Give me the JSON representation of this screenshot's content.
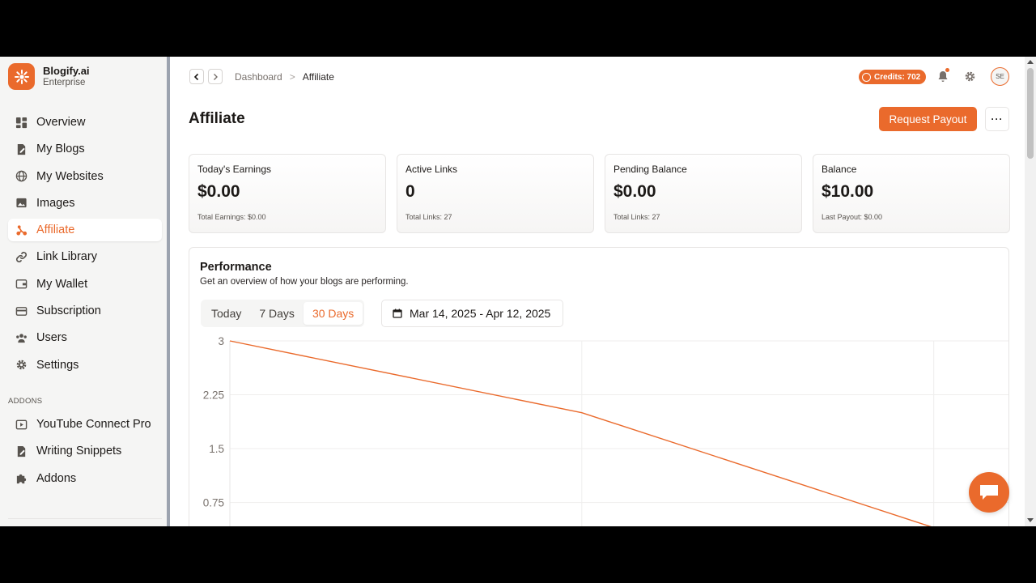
{
  "brand": {
    "name": "Blogify.ai",
    "plan": "Enterprise"
  },
  "sidebar": {
    "items": [
      {
        "label": "Overview",
        "icon": "dashboard-icon"
      },
      {
        "label": "My Blogs",
        "icon": "blog-icon"
      },
      {
        "label": "My Websites",
        "icon": "globe-icon"
      },
      {
        "label": "Images",
        "icon": "image-icon"
      },
      {
        "label": "Affiliate",
        "icon": "affiliate-icon",
        "active": true
      },
      {
        "label": "Link Library",
        "icon": "link-icon"
      },
      {
        "label": "My Wallet",
        "icon": "wallet-icon"
      },
      {
        "label": "Subscription",
        "icon": "card-icon"
      },
      {
        "label": "Users",
        "icon": "users-icon"
      },
      {
        "label": "Settings",
        "icon": "gear-icon"
      }
    ],
    "addons_heading": "ADDONS",
    "addons": [
      {
        "label": "YouTube Connect Pro",
        "icon": "youtube-icon"
      },
      {
        "label": "Writing Snippets",
        "icon": "snippet-icon"
      },
      {
        "label": "Addons",
        "icon": "puzzle-icon"
      }
    ]
  },
  "breadcrumb": {
    "parent": "Dashboard",
    "separator": ">",
    "current": "Affiliate"
  },
  "header": {
    "credits": "Credits: 702",
    "avatar_initials": "SE"
  },
  "page": {
    "title": "Affiliate",
    "payout_button": "Request Payout",
    "more_button": "···"
  },
  "stats": [
    {
      "label": "Today's Earnings",
      "value": "$0.00",
      "sub": "Total Earnings: $0.00"
    },
    {
      "label": "Active Links",
      "value": "0",
      "sub": "Total Links: 27"
    },
    {
      "label": "Pending Balance",
      "value": "$0.00",
      "sub": "Total Links: 27"
    },
    {
      "label": "Balance",
      "value": "$10.00",
      "sub": "Last Payout: $0.00"
    }
  ],
  "performance": {
    "title": "Performance",
    "subtitle": "Get an overview of how your blogs are performing.",
    "tabs": [
      "Today",
      "7 Days",
      "30 Days"
    ],
    "selected_tab": "30 Days",
    "date_range": "Mar 14, 2025 - Apr 12, 2025"
  },
  "colors": {
    "accent": "#ea6a2c",
    "text": "#1c1917",
    "muted": "#78716c",
    "border": "#e7e5e4"
  },
  "chart_data": {
    "type": "line",
    "x": [
      0,
      1,
      2
    ],
    "series": [
      {
        "values": [
          3,
          2,
          0.4
        ]
      }
    ],
    "ylim": [
      0,
      3
    ],
    "yticks": [
      "3",
      "2.25",
      "1.5",
      "0.75"
    ],
    "grid": true
  }
}
